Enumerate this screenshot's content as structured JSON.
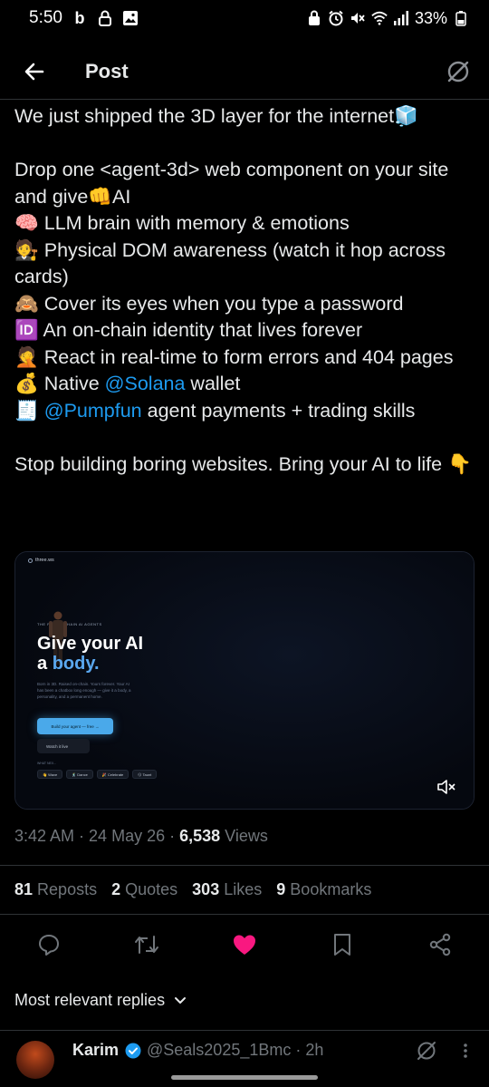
{
  "status_bar": {
    "time": "5:50",
    "battery": "33%"
  },
  "header": {
    "title": "Post"
  },
  "post": {
    "line1": "We just shipped the 3D layer for the internet🧊",
    "line2": "Drop one <agent-3d> web component on your site and give👊AI",
    "bullet1": "🧠 LLM brain with memory & emotions",
    "bullet2": "🧑‍⚖️ Physical DOM awareness (watch it hop across cards)",
    "bullet3": "🙈 Cover its eyes when you type a password",
    "bullet4": "🆔 An on-chain identity that lives forever",
    "bullet5": "🤦 React in real-time to form errors and 404 pages",
    "bullet6_prefix": "💰 Native ",
    "bullet6_mention": "@Solana",
    "bullet6_suffix": " wallet",
    "bullet7_prefix": "🧾 ",
    "bullet7_mention": "@Pumpfun",
    "bullet7_suffix": " agent payments + trading skills",
    "closing": "Stop building boring websites. Bring your AI to life 👇"
  },
  "media": {
    "brand": "three.ws",
    "kicker": "THE FOR ONCHAIN AI AGENTS",
    "headline1": "Give your AI",
    "headline2_prefix": "a ",
    "headline2_accent": "body.",
    "subtext": "Born in 3D. Raised on-chain. Yours forever. Your AI has been a chatbox long enough — give it a body, a personality, and a permanent home.",
    "cta": "Build your agent — free →",
    "watch": "Watch it live",
    "what_label": "WHAT NEX...",
    "chips": [
      "👋 Wave",
      "🕺 Dance",
      "🎉 Celebrate",
      "😏 Taunt"
    ]
  },
  "meta": {
    "time": "3:42 AM",
    "date": "24 May 26",
    "views_count": "6,538",
    "views_label": "Views"
  },
  "stats": {
    "reposts_count": "81",
    "reposts_label": "Reposts",
    "quotes_count": "2",
    "quotes_label": "Quotes",
    "likes_count": "303",
    "likes_label": "Likes",
    "bookmarks_count": "9",
    "bookmarks_label": "Bookmarks"
  },
  "replies": {
    "sort_label": "Most relevant replies"
  },
  "reply": {
    "name": "Karim",
    "handle": "@Seals2025_1Bmc · 2h"
  },
  "colors": {
    "accent": "#1d9bf0",
    "like": "#f91880",
    "muted": "#71767b"
  }
}
